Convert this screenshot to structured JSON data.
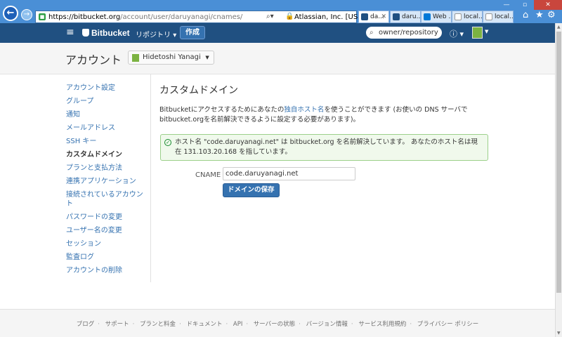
{
  "browser": {
    "url_host": "https://bitbucket.org",
    "url_path": "/account/user/daruyanagi/cnames/",
    "cert_org": "Atlassian, Inc. [US]",
    "tabs": [
      {
        "label": "da...",
        "active": true
      },
      {
        "label": "daru...",
        "active": false
      },
      {
        "label": "Web ...",
        "active": false
      },
      {
        "label": "local...",
        "active": false
      },
      {
        "label": "local...",
        "active": false
      }
    ]
  },
  "header": {
    "logo": "Bitbucket",
    "repos": "リポジトリ",
    "create": "作成",
    "search_placeholder": "owner/repository"
  },
  "page": {
    "title": "アカウント",
    "account_name": "Hidetoshi Yanagi"
  },
  "sidebar": {
    "items": [
      {
        "label": "アカウント設定"
      },
      {
        "label": "グループ"
      },
      {
        "label": "通知"
      },
      {
        "label": "メールアドレス"
      },
      {
        "label": "SSH キー"
      },
      {
        "label": "カスタムドメイン"
      },
      {
        "label": "プランと支払方法"
      },
      {
        "label": "連携アプリケーション"
      },
      {
        "label": "接続されているアカウント"
      },
      {
        "label": "パスワードの変更"
      },
      {
        "label": "ユーザー名の変更"
      },
      {
        "label": "セッション"
      },
      {
        "label": "監査ログ"
      },
      {
        "label": "アカウントの削除"
      }
    ]
  },
  "content": {
    "heading": "カスタムドメイン",
    "desc_pre": "Bitbucketにアクセスするためにあなたの",
    "desc_link": "独自ホスト名",
    "desc_post": "を使うことができます (お使いの DNS サーバでbitbucket.orgを名前解決できるように設定する必要があります)。",
    "success_message": "ホスト名 \"code.daruyanagi.net\" は bitbucket.org を名前解決しています。 あなたのホスト名は現在 131.103.20.168 を指しています。",
    "cname_label": "CNAME",
    "cname_value": "code.daruyanagi.net",
    "save_button": "ドメインの保存"
  },
  "footer": {
    "links": [
      "ブログ",
      "サポート",
      "プランと料金",
      "ドキュメント",
      "API",
      "サーバーの状態",
      "バージョン情報",
      "サービス利用規約",
      "プライバシー ポリシー"
    ]
  }
}
